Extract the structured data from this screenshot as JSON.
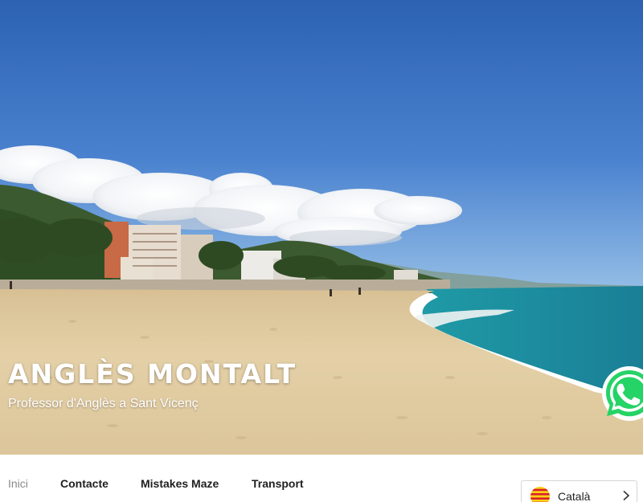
{
  "hero": {
    "title": "ANGLÈS MONTALT",
    "subtitle": "Professor d'Anglès a Sant Vicenç",
    "image_alt": "Beach panorama at Sant Vicenç de Montalt"
  },
  "nav": {
    "items": [
      {
        "label": "Inici",
        "active": true
      },
      {
        "label": "Contacte",
        "active": false
      },
      {
        "label": "Mistakes Maze",
        "active": false
      },
      {
        "label": "Transport",
        "active": false
      }
    ]
  },
  "language": {
    "current": "Català",
    "flag_icon": "catalan-flag-icon",
    "chevron_icon": "chevron-right-icon"
  },
  "whatsapp": {
    "icon": "whatsapp-icon",
    "color": "#25D366"
  },
  "colors": {
    "nav_text": "#1f1f1f",
    "nav_active": "#8a8a8a",
    "sky_top": "#2e63b4",
    "sea": "#1e8fa0",
    "sand": "#e3cfa4"
  }
}
